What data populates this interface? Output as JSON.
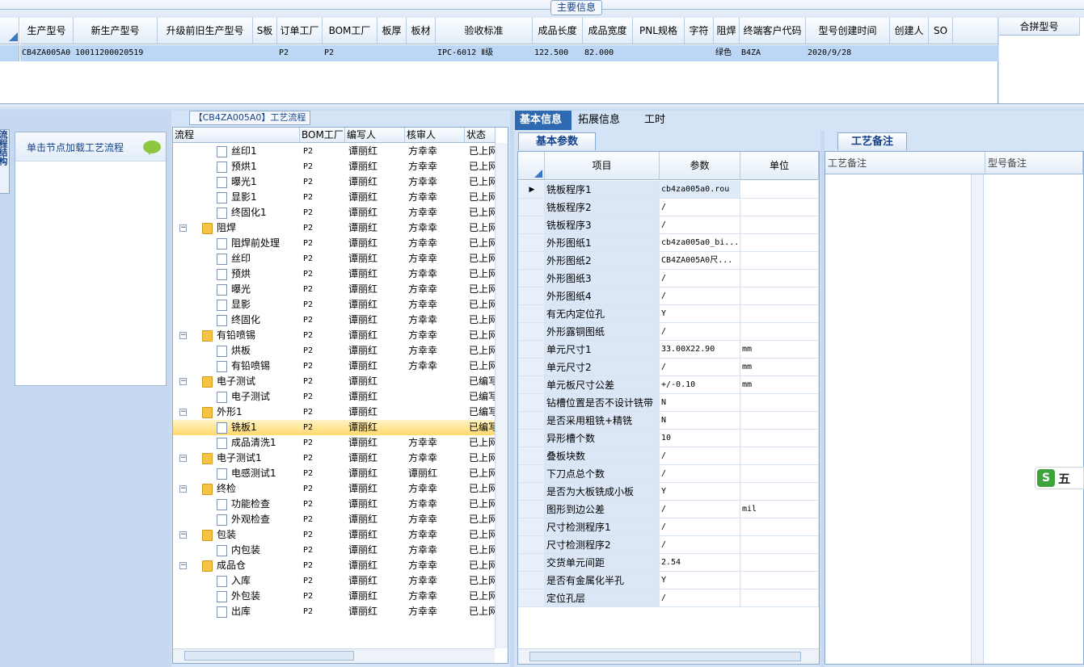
{
  "top": {
    "title": "主要信息"
  },
  "main_grid": {
    "columns": [
      "生产型号",
      "新生产型号",
      "升级前旧生产型号",
      "S板",
      "订单工厂",
      "BOM工厂",
      "板厚",
      "板材",
      "验收标准",
      "成品长度",
      "成品宽度",
      "PNL规格",
      "字符",
      "阻焊",
      "终端客户代码",
      "型号创建时间",
      "创建人",
      "SO"
    ],
    "row": [
      "CB4ZA005A0",
      "10011200020519",
      "",
      "",
      "P2",
      "P2",
      "",
      "",
      "IPC-6012 Ⅱ级",
      "122.500",
      "82.000",
      "",
      "",
      "绿色",
      "B4ZA",
      "2020/9/28",
      "",
      ""
    ]
  },
  "merge_grid": {
    "column": "合拼型号"
  },
  "sidebar": {
    "tab_label": "流程结构",
    "hint": "单击节点加载工艺流程"
  },
  "tree": {
    "title": "【CB4ZA005A0】工艺流程",
    "columns": [
      "流程",
      "BOM工厂",
      "编写人",
      "核审人",
      "状态"
    ],
    "rows": [
      {
        "level": 2,
        "kind": "doc",
        "name": "丝印1",
        "bom": "P2",
        "writer": "谭丽红",
        "checker": "方幸幸",
        "status": "已上网"
      },
      {
        "level": 2,
        "kind": "doc",
        "name": "预烘1",
        "bom": "P2",
        "writer": "谭丽红",
        "checker": "方幸幸",
        "status": "已上网"
      },
      {
        "level": 2,
        "kind": "doc",
        "name": "曝光1",
        "bom": "P2",
        "writer": "谭丽红",
        "checker": "方幸幸",
        "status": "已上网"
      },
      {
        "level": 2,
        "kind": "doc",
        "name": "显影1",
        "bom": "P2",
        "writer": "谭丽红",
        "checker": "方幸幸",
        "status": "已上网"
      },
      {
        "level": 2,
        "kind": "doc",
        "name": "终固化1",
        "bom": "P2",
        "writer": "谭丽红",
        "checker": "方幸幸",
        "status": "已上网"
      },
      {
        "level": 1,
        "kind": "folder",
        "name": "阻焊",
        "bom": "P2",
        "writer": "谭丽红",
        "checker": "方幸幸",
        "status": "已上网"
      },
      {
        "level": 2,
        "kind": "doc",
        "name": "阻焊前处理",
        "bom": "P2",
        "writer": "谭丽红",
        "checker": "方幸幸",
        "status": "已上网"
      },
      {
        "level": 2,
        "kind": "doc",
        "name": "丝印",
        "bom": "P2",
        "writer": "谭丽红",
        "checker": "方幸幸",
        "status": "已上网"
      },
      {
        "level": 2,
        "kind": "doc",
        "name": "预烘",
        "bom": "P2",
        "writer": "谭丽红",
        "checker": "方幸幸",
        "status": "已上网"
      },
      {
        "level": 2,
        "kind": "doc",
        "name": "曝光",
        "bom": "P2",
        "writer": "谭丽红",
        "checker": "方幸幸",
        "status": "已上网"
      },
      {
        "level": 2,
        "kind": "doc",
        "name": "显影",
        "bom": "P2",
        "writer": "谭丽红",
        "checker": "方幸幸",
        "status": "已上网"
      },
      {
        "level": 2,
        "kind": "doc",
        "name": "终固化",
        "bom": "P2",
        "writer": "谭丽红",
        "checker": "方幸幸",
        "status": "已上网"
      },
      {
        "level": 1,
        "kind": "folder",
        "name": "有铅喷锡",
        "bom": "P2",
        "writer": "谭丽红",
        "checker": "方幸幸",
        "status": "已上网"
      },
      {
        "level": 2,
        "kind": "doc",
        "name": "烘板",
        "bom": "P2",
        "writer": "谭丽红",
        "checker": "方幸幸",
        "status": "已上网"
      },
      {
        "level": 2,
        "kind": "doc",
        "name": "有铅喷锡",
        "bom": "P2",
        "writer": "谭丽红",
        "checker": "方幸幸",
        "status": "已上网"
      },
      {
        "level": 1,
        "kind": "folder",
        "name": "电子测试",
        "bom": "P2",
        "writer": "谭丽红",
        "checker": "",
        "status": "已编写"
      },
      {
        "level": 2,
        "kind": "doc",
        "name": "电子测试",
        "bom": "P2",
        "writer": "谭丽红",
        "checker": "",
        "status": "已编写"
      },
      {
        "level": 1,
        "kind": "folder",
        "name": "外形1",
        "bom": "P2",
        "writer": "谭丽红",
        "checker": "",
        "status": "已编写"
      },
      {
        "level": 2,
        "kind": "doc",
        "name": "铣板1",
        "bom": "P2",
        "writer": "谭丽红",
        "checker": "",
        "status": "已编写",
        "selected": true
      },
      {
        "level": 2,
        "kind": "doc",
        "name": "成品清洗1",
        "bom": "P2",
        "writer": "谭丽红",
        "checker": "方幸幸",
        "status": "已上网"
      },
      {
        "level": 1,
        "kind": "folder",
        "name": "电子测试1",
        "bom": "P2",
        "writer": "谭丽红",
        "checker": "方幸幸",
        "status": "已上网"
      },
      {
        "level": 2,
        "kind": "doc",
        "name": "电感测试1",
        "bom": "P2",
        "writer": "谭丽红",
        "checker": "谭丽红",
        "status": "已上网"
      },
      {
        "level": 1,
        "kind": "folder",
        "name": "终检",
        "bom": "P2",
        "writer": "谭丽红",
        "checker": "方幸幸",
        "status": "已上网"
      },
      {
        "level": 2,
        "kind": "doc",
        "name": "功能检查",
        "bom": "P2",
        "writer": "谭丽红",
        "checker": "方幸幸",
        "status": "已上网"
      },
      {
        "level": 2,
        "kind": "doc",
        "name": "外观检查",
        "bom": "P2",
        "writer": "谭丽红",
        "checker": "方幸幸",
        "status": "已上网"
      },
      {
        "level": 1,
        "kind": "folder",
        "name": "包装",
        "bom": "P2",
        "writer": "谭丽红",
        "checker": "方幸幸",
        "status": "已上网"
      },
      {
        "level": 2,
        "kind": "doc",
        "name": "内包装",
        "bom": "P2",
        "writer": "谭丽红",
        "checker": "方幸幸",
        "status": "已上网"
      },
      {
        "level": 1,
        "kind": "folder",
        "name": "成品仓",
        "bom": "P2",
        "writer": "谭丽红",
        "checker": "方幸幸",
        "status": "已上网"
      },
      {
        "level": 2,
        "kind": "doc",
        "name": "入库",
        "bom": "P2",
        "writer": "谭丽红",
        "checker": "方幸幸",
        "status": "已上网"
      },
      {
        "level": 2,
        "kind": "doc",
        "name": "外包装",
        "bom": "P2",
        "writer": "谭丽红",
        "checker": "方幸幸",
        "status": "已上网"
      },
      {
        "level": 2,
        "kind": "doc",
        "name": "出库",
        "bom": "P2",
        "writer": "谭丽红",
        "checker": "方幸幸",
        "status": "已上网"
      }
    ]
  },
  "right_tabs": [
    {
      "label": "基本信息",
      "active": true
    },
    {
      "label": "拓展信息",
      "active": false
    },
    {
      "label": "工时",
      "active": false
    }
  ],
  "basic_params": {
    "tab_label": "基本参数",
    "columns": [
      "项目",
      "参数",
      "单位"
    ],
    "rows": [
      {
        "item": "铣板程序1",
        "value": "cb4za005a0.rou",
        "unit": "",
        "current": true
      },
      {
        "item": "铣板程序2",
        "value": "/",
        "unit": ""
      },
      {
        "item": "铣板程序3",
        "value": "/",
        "unit": ""
      },
      {
        "item": "外形图纸1",
        "value": "cb4za005a0_bi...",
        "unit": ""
      },
      {
        "item": "外形图纸2",
        "value": "CB4ZA005A0尺...",
        "unit": ""
      },
      {
        "item": "外形图纸3",
        "value": "/",
        "unit": ""
      },
      {
        "item": "外形图纸4",
        "value": "/",
        "unit": ""
      },
      {
        "item": "有无内定位孔",
        "value": "Y",
        "unit": ""
      },
      {
        "item": "外形露铜图纸",
        "value": "/",
        "unit": ""
      },
      {
        "item": "单元尺寸1",
        "value": "33.00X22.90",
        "unit": "mm"
      },
      {
        "item": "单元尺寸2",
        "value": "/",
        "unit": "mm"
      },
      {
        "item": "单元板尺寸公差",
        "value": "+/-0.10",
        "unit": "mm"
      },
      {
        "item": "钻槽位置是否不设计铣带",
        "value": "N",
        "unit": ""
      },
      {
        "item": "是否采用粗铣+精铣",
        "value": "N",
        "unit": ""
      },
      {
        "item": "异形槽个数",
        "value": "10",
        "unit": ""
      },
      {
        "item": "叠板块数",
        "value": "/",
        "unit": ""
      },
      {
        "item": "下刀点总个数",
        "value": "/",
        "unit": ""
      },
      {
        "item": "是否为大板铣成小板",
        "value": "Y",
        "unit": ""
      },
      {
        "item": "图形到边公差",
        "value": "/",
        "unit": "mil"
      },
      {
        "item": "尺寸检测程序1",
        "value": "/",
        "unit": ""
      },
      {
        "item": "尺寸检测程序2",
        "value": "/",
        "unit": ""
      },
      {
        "item": "交货单元间距",
        "value": "2.54",
        "unit": ""
      },
      {
        "item": "是否有金属化半孔",
        "value": "Y",
        "unit": ""
      },
      {
        "item": "定位孔层",
        "value": "/",
        "unit": ""
      }
    ]
  },
  "notes": {
    "tab_label": "工艺备注",
    "col1": "工艺备注",
    "col2": "型号备注"
  },
  "ime": {
    "logo": "S",
    "mode": "五"
  },
  "colors": {
    "accent": "#2e6ab1",
    "selected_row": "#ffd96a",
    "header_bg": "#e3edf8"
  }
}
